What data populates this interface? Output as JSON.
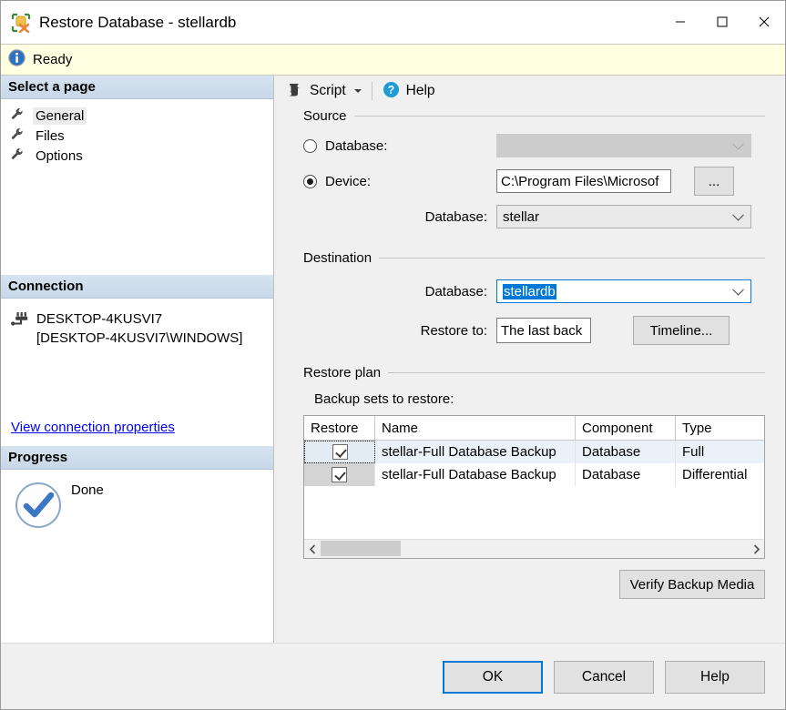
{
  "window": {
    "title": "Restore Database - stellardb",
    "icon": "restore-database-icon",
    "minimize_label": "Minimize",
    "maximize_label": "Maximize",
    "close_label": "Close"
  },
  "status": {
    "icon": "info-icon",
    "text": "Ready"
  },
  "sidebar": {
    "select_page_header": "Select a page",
    "items": [
      {
        "label": "General",
        "icon": "wrench-icon",
        "selected": true
      },
      {
        "label": "Files",
        "icon": "wrench-icon",
        "selected": false
      },
      {
        "label": "Options",
        "icon": "wrench-icon",
        "selected": false
      }
    ],
    "connection": {
      "header": "Connection",
      "icon": "server-connection-icon",
      "server_line1": "DESKTOP-4KUSVI7",
      "server_line2": "[DESKTOP-4KUSVI7\\WINDOWS]",
      "link": "View connection properties"
    },
    "progress": {
      "header": "Progress",
      "icon": "check-circle-icon",
      "status": "Done"
    }
  },
  "toolbar": {
    "script_label": "Script",
    "script_icon": "script-icon",
    "script_caret": "chevron-down-icon",
    "help_label": "Help",
    "help_icon": "help-icon"
  },
  "source": {
    "title": "Source",
    "database_radio_label": "Database:",
    "database_radio_checked": false,
    "database_combo_value": "",
    "device_radio_label": "Device:",
    "device_radio_checked": true,
    "device_path": "C:\\Program Files\\Microsof",
    "browse_button": "...",
    "device_database_label": "Database:",
    "device_database_value": "stellar"
  },
  "destination": {
    "title": "Destination",
    "database_label": "Database:",
    "database_value": "stellardb",
    "restore_to_label": "Restore to:",
    "restore_to_value": "The last back",
    "timeline_button": "Timeline..."
  },
  "restore_plan": {
    "title": "Restore plan",
    "backup_sets_label": "Backup sets to restore:",
    "columns": [
      "Restore",
      "Name",
      "Component",
      "Type"
    ],
    "rows": [
      {
        "restore": true,
        "name": "stellar-Full Database Backup",
        "component": "Database",
        "type": "Full",
        "selected": true
      },
      {
        "restore": true,
        "name": "stellar-Full Database Backup",
        "component": "Database",
        "type": "Differential",
        "selected": false
      }
    ],
    "scroll_left_icon": "chevron-left-icon",
    "scroll_right_icon": "chevron-right-icon",
    "verify_button": "Verify Backup Media"
  },
  "footer": {
    "ok": "OK",
    "cancel": "Cancel",
    "help": "Help"
  },
  "colors": {
    "accent": "#0078d7",
    "status_bg": "#ffffe1",
    "pane_header_bg": "#c8d8e8",
    "selection_blue": "#0078d7"
  }
}
